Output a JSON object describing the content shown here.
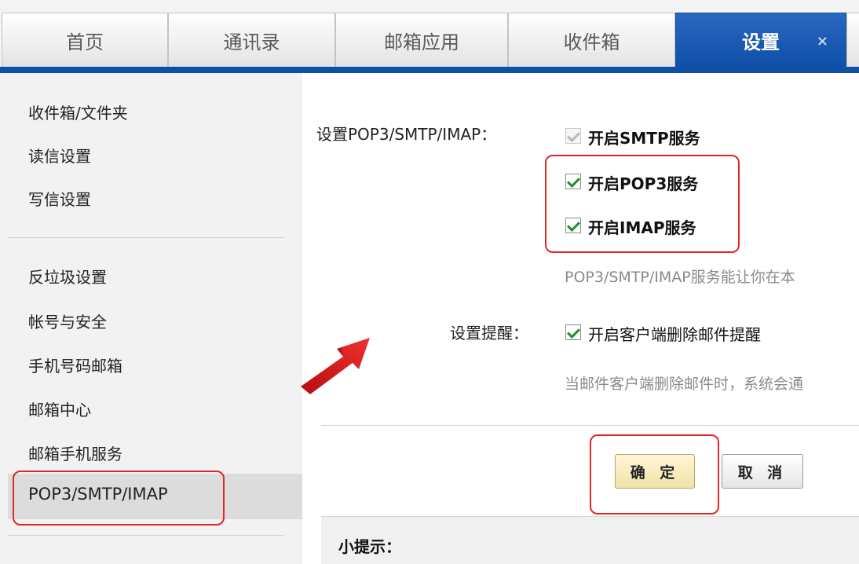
{
  "tabs": [
    {
      "label": "首页"
    },
    {
      "label": "通讯录"
    },
    {
      "label": "邮箱应用"
    },
    {
      "label": "收件箱"
    },
    {
      "label": "设置",
      "active": true,
      "close": "×"
    }
  ],
  "sidebar": {
    "group1": [
      "收件箱/文件夹",
      "读信设置",
      "写信设置"
    ],
    "group2": [
      "反垃圾设置",
      "帐号与安全",
      "手机号码邮箱",
      "邮箱中心",
      "邮箱手机服务"
    ],
    "selected": "POP3/SMTP/IMAP"
  },
  "settings": {
    "pop_label": "设置POP3/SMTP/IMAP：",
    "smtp": {
      "label": "开启SMTP服务",
      "checked": true,
      "disabled": true
    },
    "pop3": {
      "label": "开启POP3服务",
      "checked": true
    },
    "imap": {
      "label": "开启IMAP服务",
      "checked": true
    },
    "pop_hint": "POP3/SMTP/IMAP服务能让你在本",
    "reminder_label": "设置提醒：",
    "delete_reminder": {
      "label": "开启客户端删除邮件提醒",
      "checked": true
    },
    "delete_hint": "当邮件客户端删除邮件时，系统会通"
  },
  "buttons": {
    "ok": "确 定",
    "cancel": "取 消"
  },
  "tips": {
    "title": "小提示："
  },
  "colors": {
    "accent": "#0f4fa8",
    "highlight": "#e32626",
    "check": "#1f8f2a"
  }
}
